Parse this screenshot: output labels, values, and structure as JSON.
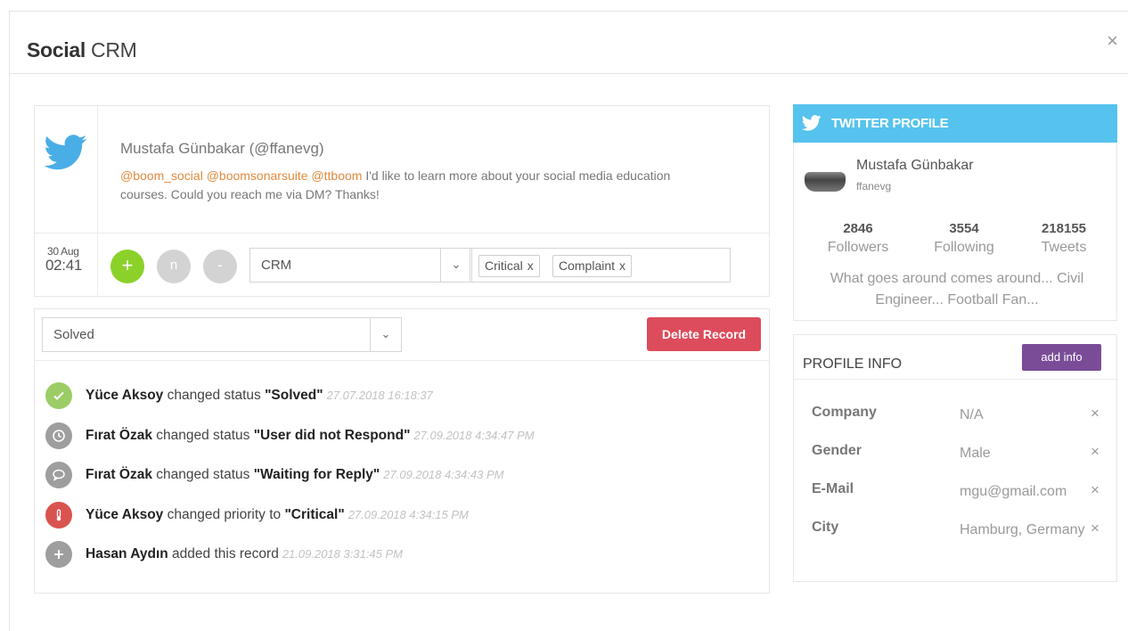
{
  "modal": {
    "title_bold": "Social",
    "title_rest": " CRM",
    "close": "×"
  },
  "tweet": {
    "author": "Mustafa Günbakar (@ffanevg)",
    "mentions": "@boom_social @boomsonarsuite @ttboom",
    "text": " I'd like to learn more about your social media education courses. Could you reach me via DM? Thanks!",
    "date_day": "30 Aug",
    "date_time": "02:41",
    "btn_add": "+",
    "btn_n": "n",
    "btn_minus": "-",
    "category_select": "CRM",
    "tags": [
      "Critical",
      "Complaint"
    ],
    "tag_remove": "x"
  },
  "status": {
    "selected": "Solved",
    "delete_label": "Delete Record"
  },
  "history": [
    {
      "user": "Yüce Aksoy",
      "action": " changed status ",
      "value": "\"Solved\"",
      "date": "27.07.2018 16:18:37",
      "icon": "check-icon",
      "color": "#9ccc65"
    },
    {
      "user": "Fırat Özak",
      "action": " changed status ",
      "value": "\"User did not Respond\"",
      "date": "27.09.2018 4:34:47 PM",
      "icon": "clock-icon",
      "color": "#9e9e9e"
    },
    {
      "user": "Fırat Özak",
      "action": " changed status ",
      "value": "\"Waiting for Reply\"",
      "date": "27.09.2018 4:34:43 PM",
      "icon": "chat-icon",
      "color": "#9e9e9e"
    },
    {
      "user": "Yüce Aksoy",
      "action": " changed priority to ",
      "value": "\"Critical\"",
      "date": "27.09.2018 4:34:15 PM",
      "icon": "thermometer-icon",
      "color": "#d9534f"
    },
    {
      "user": "Hasan Aydın",
      "action": " added this record",
      "value": "",
      "date": "21.09.2018 3:31:45 PM",
      "icon": "plus-icon",
      "color": "#9e9e9e"
    }
  ],
  "twitter_profile": {
    "header": "TWITTER PROFILE",
    "name": "Mustafa Günbakar",
    "handle": "ffanevg",
    "stats": [
      {
        "num": "2846",
        "label": "Followers"
      },
      {
        "num": "3554",
        "label": "Following"
      },
      {
        "num": "218155",
        "label": "Tweets"
      }
    ],
    "bio": "What goes around comes around... Civil Engineer... Football Fan..."
  },
  "profile_info": {
    "title": "PROFILE INFO",
    "add_label": "add info",
    "remove": "×",
    "rows": [
      {
        "key": "Company",
        "value": "N/A"
      },
      {
        "key": "Gender",
        "value": "Male"
      },
      {
        "key": "E-Mail",
        "value": "mgu@gmail.com"
      },
      {
        "key": "City",
        "value": "Hamburg, Germany"
      }
    ]
  },
  "colors": {
    "twitter": "#55c3ed",
    "delete": "#dc4c5c",
    "add_info": "#7a4c98",
    "add_green": "#8bd12a",
    "mention": "#e08a3c"
  }
}
